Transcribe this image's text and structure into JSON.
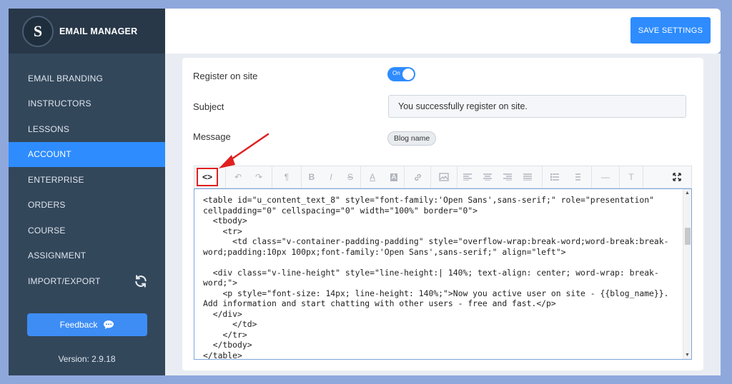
{
  "app": {
    "title": "EMAIL MANAGER",
    "logo_letter": "S"
  },
  "sidebar": {
    "items": [
      {
        "label": "EMAIL BRANDING",
        "active": false
      },
      {
        "label": "INSTRUCTORS",
        "active": false
      },
      {
        "label": "LESSONS",
        "active": false
      },
      {
        "label": "ACCOUNT",
        "active": true
      },
      {
        "label": "ENTERPRISE",
        "active": false
      },
      {
        "label": "ORDERS",
        "active": false
      },
      {
        "label": "COURSE",
        "active": false
      },
      {
        "label": "ASSIGNMENT",
        "active": false
      },
      {
        "label": "IMPORT/EXPORT",
        "active": false
      }
    ],
    "feedback_label": "Feedback",
    "version": "Version: 2.9.18"
  },
  "header": {
    "save_label": "SAVE SETTINGS"
  },
  "form": {
    "register_label": "Register on site",
    "toggle_text": "On",
    "subject_label": "Subject",
    "subject_value": "You successfully register on site.",
    "message_label": "Message",
    "tag_label": "Blog name"
  },
  "toolbar": {
    "code_label": "<>",
    "undo": "↶",
    "redo": "↷",
    "paragraph": "¶",
    "bold": "B",
    "italic": "I",
    "strike": "S",
    "font_color": "A",
    "bg_color": "A",
    "link": "🔗",
    "image": "▣",
    "list_ul": "☰",
    "list_ol": "☰",
    "hr": "—",
    "clear": "T"
  },
  "editor": {
    "code": "<table id=\"u_content_text_8\" style=\"font-family:'Open Sans',sans-serif;\" role=\"presentation\"\ncellpadding=\"0\" cellspacing=\"0\" width=\"100%\" border=\"0\">\n  <tbody>\n    <tr>\n      <td class=\"v-container-padding-padding\" style=\"overflow-wrap:break-word;word-break:break-word;padding:10px 100px;font-family:'Open Sans',sans-serif;\" align=\"left\">\n\n  <div class=\"v-line-height\" style=\"line-height:| 140%; text-align: center; word-wrap: break-word;\">\n    <p style=\"font-size: 14px; line-height: 140%;\">Now you active user on site - {{blog_name}}. Add information and start chatting with other users - free and fast.</p>\n  </div>\n      </td>\n    </tr>\n  </tbody>\n</table>"
  },
  "colors": {
    "accent": "#2e8cff",
    "sidebar_bg": "#33475b",
    "highlight": "#e02020"
  }
}
